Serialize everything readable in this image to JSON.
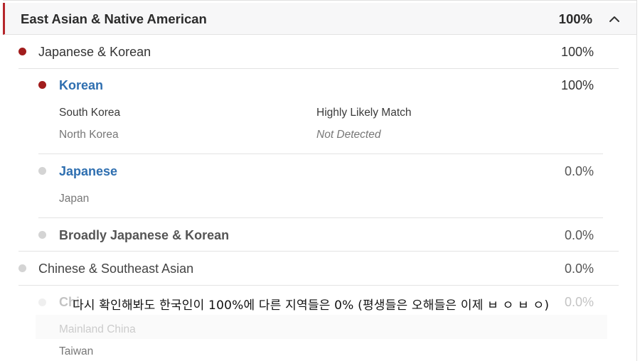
{
  "header": {
    "title": "East Asian & Native American",
    "percent": "100%",
    "chevron": "chevron-up-icon"
  },
  "groups": [
    {
      "label": "Japanese & Korean",
      "percent": "100%",
      "dot_color": "#a11c1c"
    },
    {
      "label": "Chinese & Southeast Asian",
      "percent": "0.0%",
      "dot_color": "#d4d4d4"
    }
  ],
  "subgroups": [
    {
      "label": "Korean",
      "percent": "100%",
      "dot_color": "#a11c1c",
      "regions": [
        {
          "name": "South Korea",
          "status": "Highly Likely Match"
        },
        {
          "name": "North Korea",
          "status": "Not Detected"
        }
      ]
    },
    {
      "label": "Japanese",
      "percent": "0.0%",
      "dot_color": "#d4d4d4",
      "regions": [
        {
          "name": "Japan"
        }
      ]
    },
    {
      "label": "Broadly Japanese & Korean",
      "percent": "0.0%",
      "dot_color": "#d4d4d4"
    }
  ],
  "partial": {
    "label": "Chi",
    "percent": "0.0%",
    "regions": [
      "Mainland China",
      "Taiwan"
    ]
  },
  "caption": "다시 확인해봐도 한국인이 100%에 다른 지역들은 0% (평생들은 오해들은 이제  ㅂ ㅇ ㅂ ㅇ)",
  "colors": {
    "accent": "#b5262b",
    "link": "#2f6fb0",
    "header_bg": "#f7f7f8"
  }
}
